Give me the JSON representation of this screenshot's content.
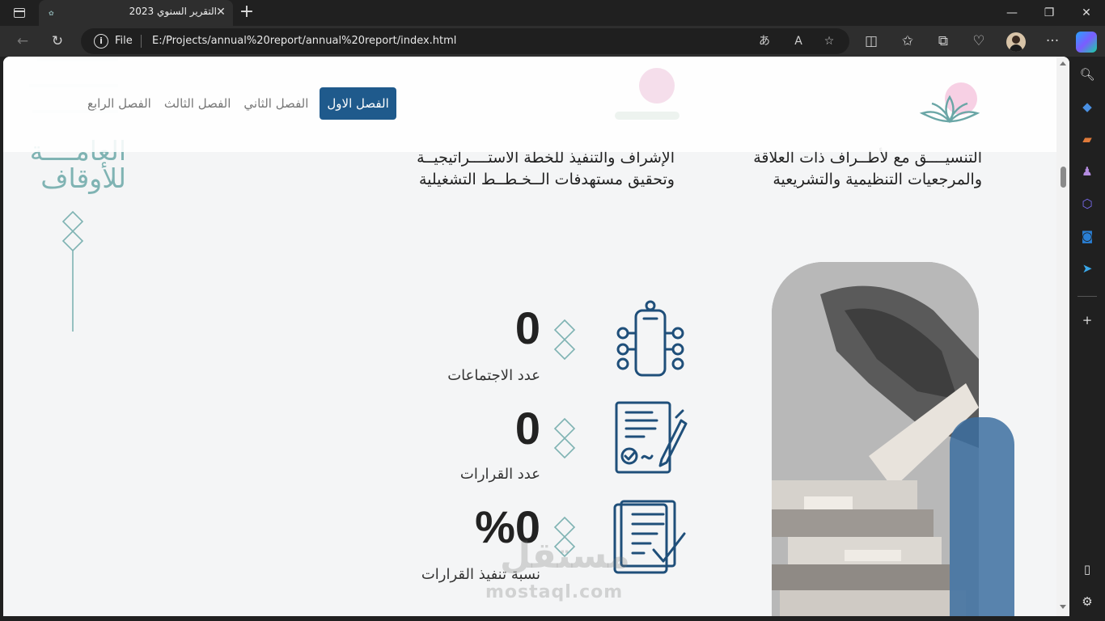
{
  "browser": {
    "tab_title": "التقرير السنوي 2023",
    "url_scheme": "File",
    "url": "E:/Projects/annual%20report/annual%20report/index.html"
  },
  "nav": {
    "items": [
      {
        "label": "الفصل الاول",
        "active": true
      },
      {
        "label": "الفصل الثاني",
        "active": false
      },
      {
        "label": "الفصل الثالث",
        "active": false
      },
      {
        "label": "الفصل الرابع",
        "active": false
      }
    ]
  },
  "side_title": {
    "line1": "العامــــة",
    "line2": "للأوقاف"
  },
  "goals": [
    "التنسيــــق مع لأطــراف ذات العلاقة والمرجعيات التنظيمية والتشريعية",
    "الإشراف والتنفيذ للخطة الاستــــراتيجيــة وتحقيق مستهدفات الــخـطــط التشغيلية"
  ],
  "stats": [
    {
      "value": "0",
      "label": "عدد الاجتماعات",
      "icon": "meeting-icon"
    },
    {
      "value": "0",
      "label": "عدد القرارات",
      "icon": "signed-document-icon"
    },
    {
      "value": "%0",
      "label": "نسبة تنفيذ القرارات",
      "icon": "checklist-icon"
    }
  ],
  "watermark": {
    "arabic": "مستقل",
    "latin": "mostaql.com"
  },
  "colors": {
    "accent": "#1f5a8c",
    "teal": "#7fb3b3",
    "icon": "#1f4f7a"
  }
}
